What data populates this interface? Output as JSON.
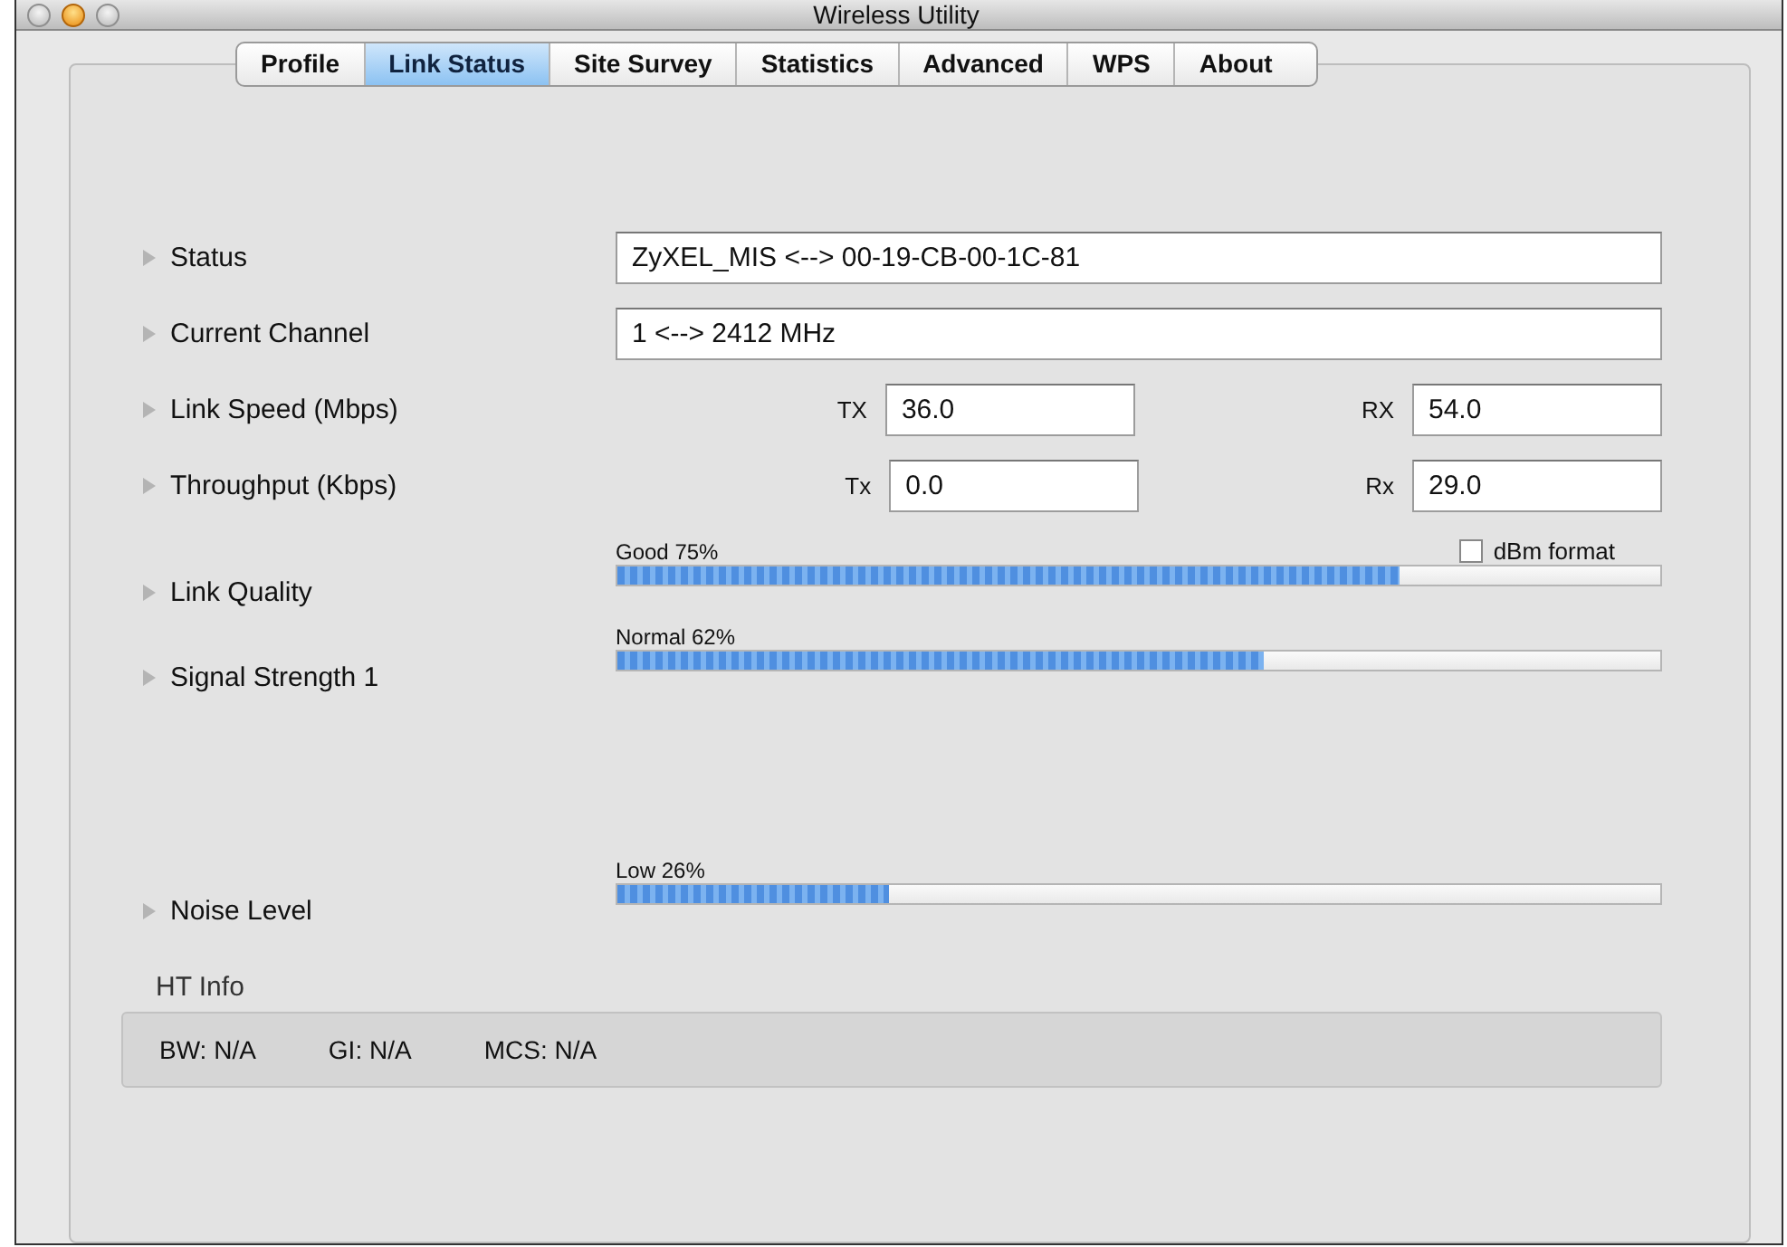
{
  "window": {
    "title": "Wireless Utility"
  },
  "tabs": [
    {
      "label": "Profile",
      "selected": false
    },
    {
      "label": "Link Status",
      "selected": true
    },
    {
      "label": "Site Survey",
      "selected": false
    },
    {
      "label": "Statistics",
      "selected": false
    },
    {
      "label": "Advanced",
      "selected": false
    },
    {
      "label": "WPS",
      "selected": false
    },
    {
      "label": "About",
      "selected": false
    }
  ],
  "rows": [
    {
      "kind": "text",
      "label": "Status",
      "value": "ZyXEL_MIS <--> 00-19-CB-00-1C-81"
    },
    {
      "kind": "text",
      "label": "Current Channel",
      "value": "1 <--> 2412 MHz"
    },
    {
      "kind": "pair",
      "label": "Link Speed (Mbps)",
      "fields": [
        {
          "label": "TX",
          "value": "36.0"
        },
        {
          "label": "RX",
          "value": "54.0"
        }
      ]
    },
    {
      "kind": "pair",
      "label": "Throughput (Kbps)",
      "fields": [
        {
          "label": "Tx",
          "value": "0.0"
        },
        {
          "label": "Rx",
          "value": "29.0"
        }
      ]
    },
    {
      "kind": "meter",
      "label": "Link Quality",
      "caption": "Good 75%",
      "level": 0.75,
      "option": {
        "label": "dBm format",
        "checked": false
      }
    },
    {
      "kind": "meter",
      "label": "Signal Strength 1",
      "caption": "Normal 62%",
      "level": 0.62
    },
    {
      "kind": "meter",
      "label": "Noise Level",
      "caption": "Low 26%",
      "level": 0.26
    }
  ],
  "ht_info": {
    "title": "HT Info",
    "items": [
      "BW: N/A",
      "GI: N/A",
      "MCS: N/A"
    ]
  }
}
